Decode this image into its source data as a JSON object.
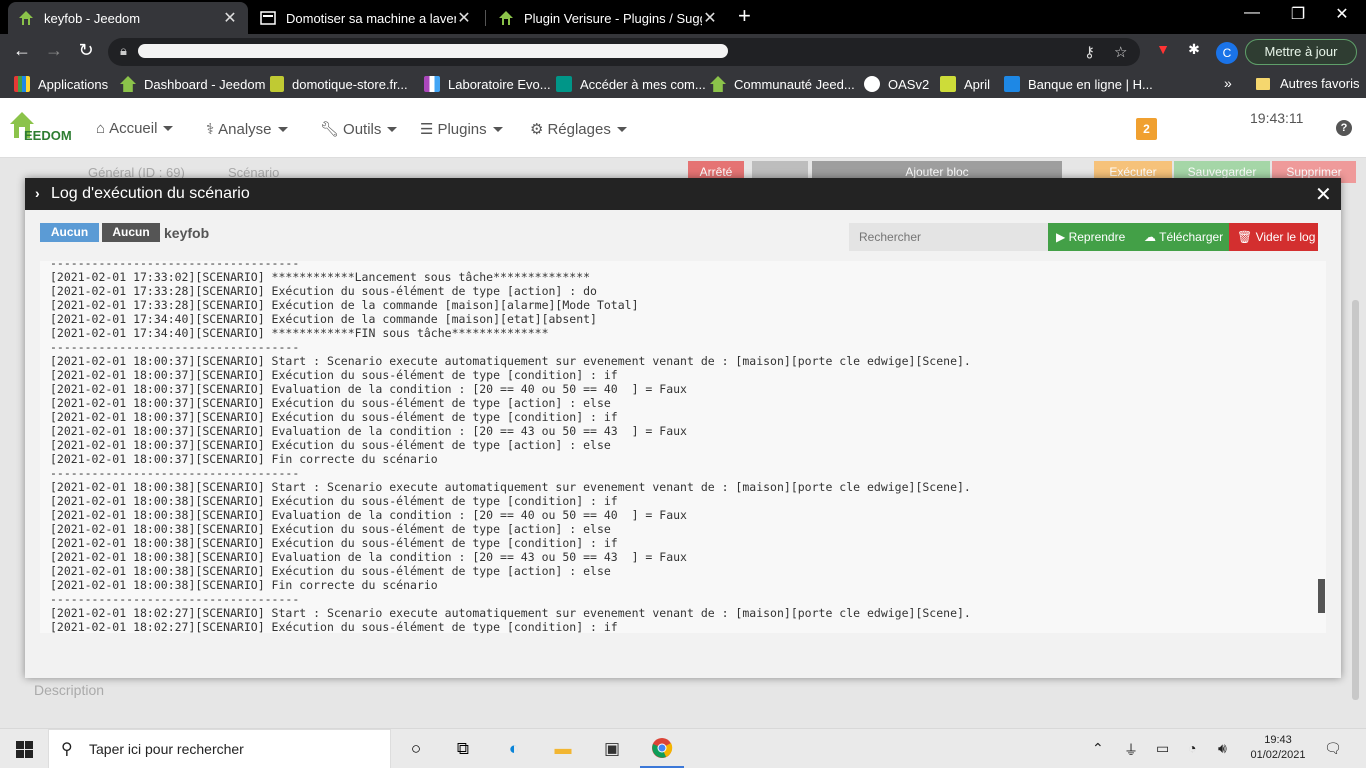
{
  "browser": {
    "tabs": [
      {
        "title": "keyfob - Jeedom",
        "active": true
      },
      {
        "title": "Domotiser sa machine a laver via",
        "active": false
      },
      {
        "title": "Plugin Verisure - Plugins / Sugge",
        "active": false
      }
    ],
    "update_button": "Mettre à jour",
    "profile_initial": "C",
    "bookmarks": [
      "Applications",
      "Dashboard - Jeedom",
      "domotique-store.fr...",
      "Laboratoire Evo...",
      "Accéder à mes com...",
      "Communauté Jeed...",
      "OASv2",
      "April",
      "Banque en ligne | H..."
    ],
    "other_bookmarks": "Autres favoris"
  },
  "jeedom": {
    "logo_text": "EEDOM",
    "menu": [
      "Accueil",
      "Analyse",
      "Outils",
      "Plugins",
      "Réglages"
    ],
    "notification_count": "2",
    "time": "19:43:11",
    "background": {
      "tab_general": "Général (ID : 69)",
      "tab_scenario": "Scénario",
      "btn_stopped": "Arrêté",
      "btn_add_block": "Ajouter bloc",
      "btn_execute": "Exécuter",
      "btn_save": "Sauvegarder",
      "btn_delete": "Supprimer",
      "description_label": "Description"
    }
  },
  "modal": {
    "title": "Log d'exécution du scénario",
    "label_group": "Aucun",
    "label_object": "Aucun",
    "scenario_name": "keyfob",
    "search_placeholder": "Rechercher",
    "btn_resume": "Reprendre",
    "btn_download": "Télécharger",
    "btn_clear": "Vider le log",
    "log_lines": [
      "------------------------------------",
      "[2021-02-01 17:33:02][SCENARIO] ************Lancement sous tâche**************",
      "[2021-02-01 17:33:28][SCENARIO] Exécution du sous-élément de type [action] : do",
      "[2021-02-01 17:33:28][SCENARIO] Exécution de la commande [maison][alarme][Mode Total]",
      "[2021-02-01 17:34:40][SCENARIO] Exécution de la commande [maison][etat][absent]",
      "[2021-02-01 17:34:40][SCENARIO] ************FIN sous tâche**************",
      "------------------------------------",
      "[2021-02-01 18:00:37][SCENARIO] Start : Scenario execute automatiquement sur evenement venant de : [maison][porte cle edwige][Scene].",
      "[2021-02-01 18:00:37][SCENARIO] Exécution du sous-élément de type [condition] : if",
      "[2021-02-01 18:00:37][SCENARIO] Evaluation de la condition : [20 == 40 ou 50 == 40  ] = Faux",
      "[2021-02-01 18:00:37][SCENARIO] Exécution du sous-élément de type [action] : else",
      "[2021-02-01 18:00:37][SCENARIO] Exécution du sous-élément de type [condition] : if",
      "[2021-02-01 18:00:37][SCENARIO] Evaluation de la condition : [20 == 43 ou 50 == 43  ] = Faux",
      "[2021-02-01 18:00:37][SCENARIO] Exécution du sous-élément de type [action] : else",
      "[2021-02-01 18:00:37][SCENARIO] Fin correcte du scénario",
      "------------------------------------",
      "[2021-02-01 18:00:38][SCENARIO] Start : Scenario execute automatiquement sur evenement venant de : [maison][porte cle edwige][Scene].",
      "[2021-02-01 18:00:38][SCENARIO] Exécution du sous-élément de type [condition] : if",
      "[2021-02-01 18:00:38][SCENARIO] Evaluation de la condition : [20 == 40 ou 50 == 40  ] = Faux",
      "[2021-02-01 18:00:38][SCENARIO] Exécution du sous-élément de type [action] : else",
      "[2021-02-01 18:00:38][SCENARIO] Exécution du sous-élément de type [condition] : if",
      "[2021-02-01 18:00:38][SCENARIO] Evaluation de la condition : [20 == 43 ou 50 == 43  ] = Faux",
      "[2021-02-01 18:00:38][SCENARIO] Exécution du sous-élément de type [action] : else",
      "[2021-02-01 18:00:38][SCENARIO] Fin correcte du scénario",
      "------------------------------------",
      "[2021-02-01 18:02:27][SCENARIO] Start : Scenario execute automatiquement sur evenement venant de : [maison][porte cle edwige][Scene].",
      "[2021-02-01 18:02:27][SCENARIO] Exécution du sous-élément de type [condition] : if"
    ]
  },
  "taskbar": {
    "search_placeholder": "Taper ici pour rechercher",
    "time": "19:43",
    "date": "01/02/2021"
  }
}
